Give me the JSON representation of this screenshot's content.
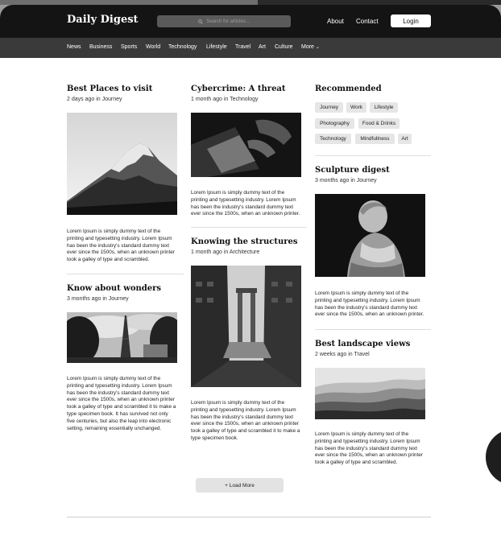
{
  "header": {
    "logo": "Daily Digest",
    "search_placeholder": "Search for articles...",
    "about": "About",
    "contact": "Contact",
    "login": "Login"
  },
  "categories": [
    "News",
    "Business",
    "Sports",
    "World",
    "Technology",
    "Lifestyle",
    "Travel",
    "Art",
    "Culture",
    "More"
  ],
  "articles": {
    "best_places": {
      "title": "Best Places to visit",
      "meta": "2 days ago in Journey",
      "text": "Lorem Ipsum is simply dummy text of the printing and typesetting industry. Lorem Ipsum has been the industry's standard dummy text ever since the 1500s, when an unknown printer took a galley of type and scrambled."
    },
    "wonders": {
      "title": "Know about wonders",
      "meta": "3 months ago in Journey",
      "text": "Lorem Ipsum is simply dummy text of the printing and typesetting industry. Lorem Ipsum has been the industry's standard dummy text ever since the 1500s, when an unknown printer took a galley of type and scrambled it to make a type specimen book. It has survived not only five centuries, but also the leap into electronic setting, remaining essentially unchanged."
    },
    "cybercrime": {
      "title": "Cybercrime: A threat",
      "meta": "1 month ago in Technology",
      "text": "Lorem Ipsum is simply dummy text of the printing and typesetting industry. Lorem Ipsum has been the industry's standard dummy text ever since the 1500s, when an unknown printer."
    },
    "structures": {
      "title": "Knowing the structures",
      "meta": "1 month ago in Architecture",
      "text": "Lorem Ipsum is simply dummy text of the printing and typesetting industry. Lorem Ipsum has been the industry's standard dummy text ever since the 1500s, when an unknown printer took a galley of type and scrambled it to make a type specimen book."
    },
    "sculpture": {
      "title": "Sculpture digest",
      "meta": "3 months ago in Journey",
      "text": "Lorem Ipsum is simply dummy text of the printing and typesetting industry. Lorem Ipsum has been the industry's standard dummy text ever since the 1500s, when an unknown printer."
    },
    "landscape": {
      "title": "Best landscape views",
      "meta": "2 weeks ago in Travel",
      "text": "Lorem Ipsum is simply dummy text of the printing and typesetting industry. Lorem Ipsum has been the industry's standard dummy text ever since the 1500s, when an unknown printer took a galley of type and scrambled."
    }
  },
  "recommended": {
    "title": "Recommended",
    "tags": [
      "Journey",
      "Work",
      "Lifestyle",
      "Photography",
      "Food & Drinks",
      "Technology",
      "Mindfullness",
      "Art"
    ]
  },
  "load_more": "+ Load More"
}
